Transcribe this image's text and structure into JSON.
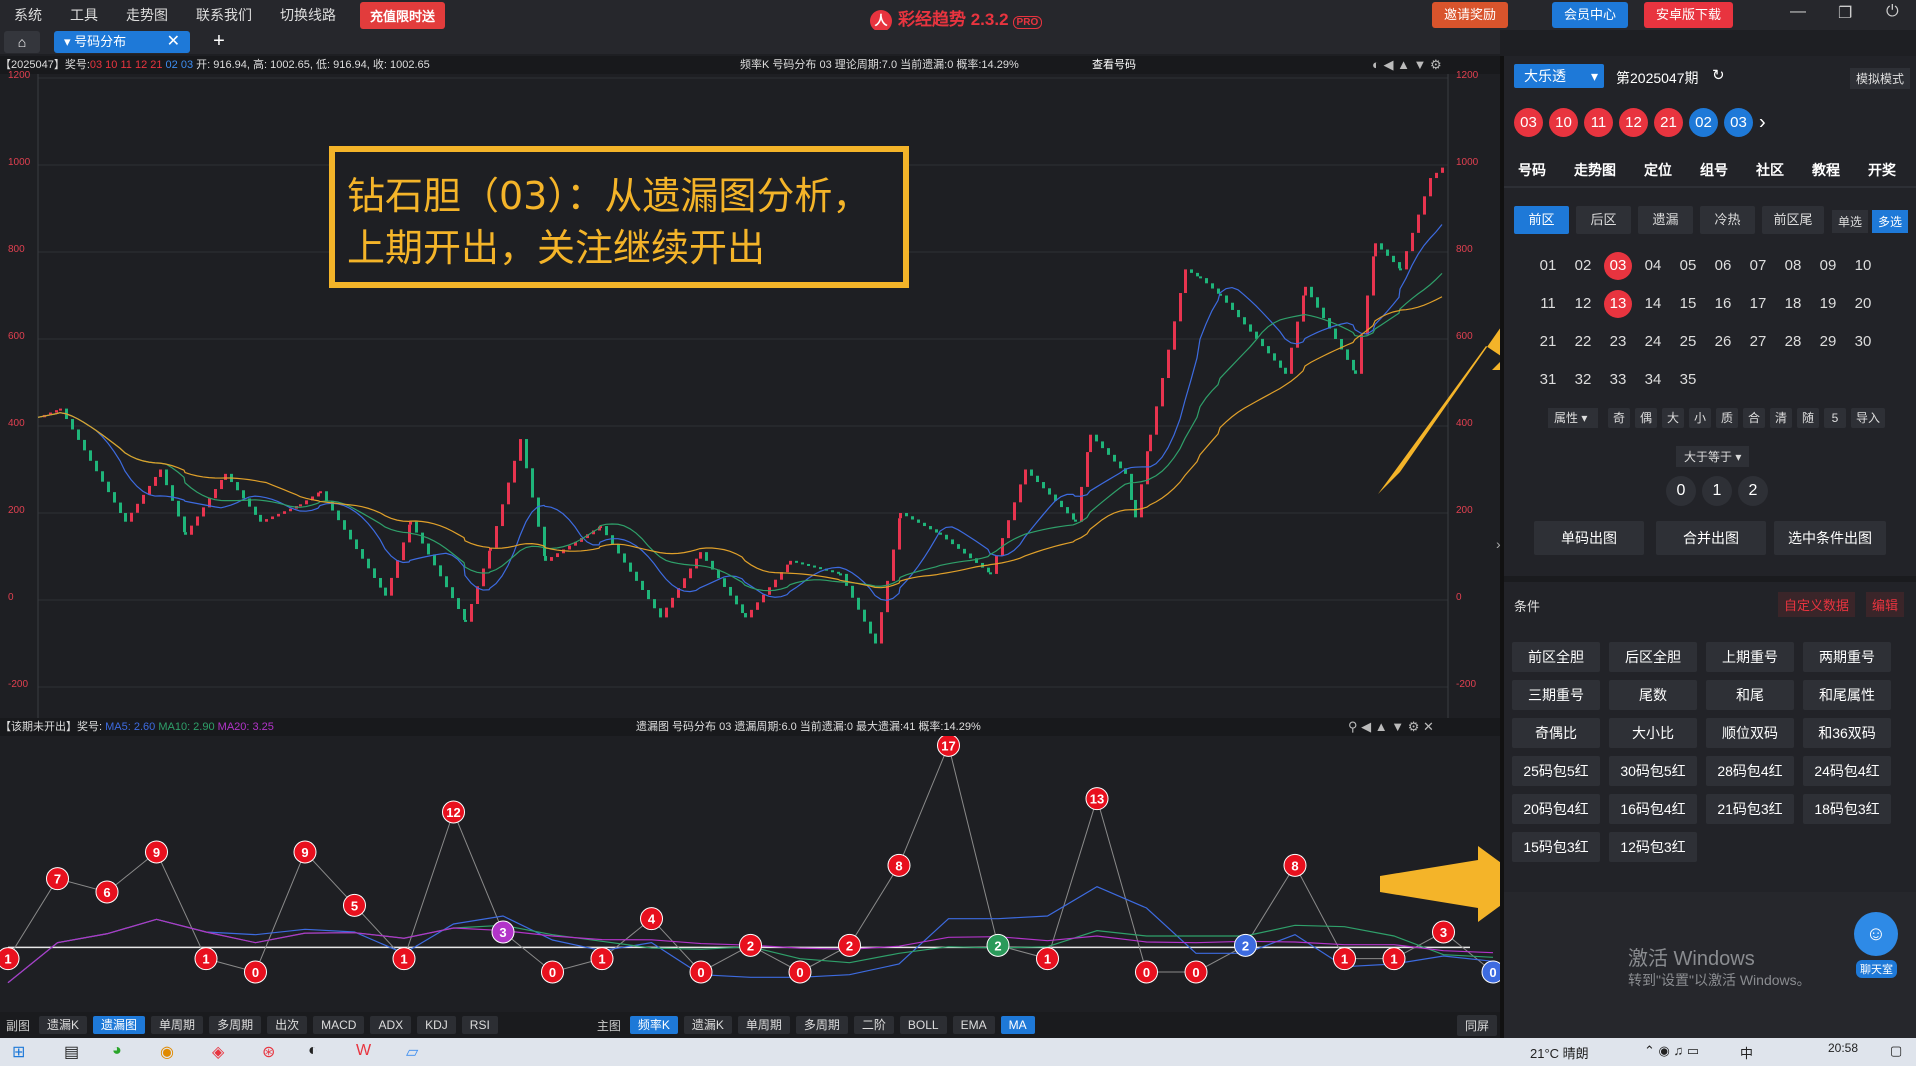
{
  "menu": [
    "系统",
    "工具",
    "走势图",
    "联系我们",
    "切换线路"
  ],
  "promo_label": "充值限时送",
  "app_title": "彩经趋势 2.3.2",
  "app_badge": "PRO",
  "top_buttons": {
    "invite": "邀请奖励",
    "member": "会员中心",
    "android": "安卓版下载"
  },
  "tab_label": "号码分布",
  "upper": {
    "header_left": "【2025047】奖号:",
    "header_nums": "03 10 11 12 21",
    "header_nums_blue": "02 03",
    "header_ohlc": "开: 916.94, 高: 1002.65, 低: 916.94, 收: 1002.65",
    "header_mid": "频率K   号码分布   03      理论周期:7.0   当前遗漏:0   概率:14.29%",
    "header_link": "查看号码",
    "axis_labels": [
      "1200",
      "1000",
      "800",
      "600",
      "400",
      "200",
      "0",
      "-200"
    ]
  },
  "overlay": {
    "line1": "钻石胆（03）：从遗漏图分析，",
    "line2": "上期开出，关注继续开出"
  },
  "lower": {
    "header_left": "【该期未开出】奖号:",
    "header_ma5": "MA5: 2.60",
    "header_ma10": "MA10: 2.90",
    "header_ma20": "MA20: 3.25",
    "header_mid": "遗漏图   号码分布   03      遗漏周期:6.0   当前遗漏:0   最大遗漏:41   概率:14.29%"
  },
  "bottom_left_label": "副图",
  "bottom_left": [
    "遗漏K",
    "遗漏图",
    "单周期",
    "多周期",
    "出次",
    "MACD",
    "ADX",
    "KDJ",
    "RSI"
  ],
  "bottom_left_active": 1,
  "bottom_right_label": "主图",
  "bottom_right": [
    "频率K",
    "遗漏K",
    "单周期",
    "多周期",
    "二阶",
    "BOLL",
    "EMA",
    "MA"
  ],
  "bottom_right_active": [
    0,
    7
  ],
  "same_screen": "同屏",
  "side": {
    "lottery": "大乐透",
    "period": "第2025047期",
    "mode": "模拟模式",
    "red_balls": [
      "03",
      "10",
      "11",
      "12",
      "21"
    ],
    "blue_balls": [
      "02",
      "03"
    ],
    "nav": [
      "号码",
      "走势图",
      "定位",
      "组号",
      "社区",
      "教程",
      "开奖"
    ],
    "subtabs": [
      "前区",
      "后区",
      "遗漏",
      "冷热",
      "前区尾"
    ],
    "single": "单选",
    "multi": "多选",
    "numbers": [
      "01",
      "02",
      "03",
      "04",
      "05",
      "06",
      "07",
      "08",
      "09",
      "10",
      "11",
      "12",
      "13",
      "14",
      "15",
      "16",
      "17",
      "18",
      "19",
      "20",
      "21",
      "22",
      "23",
      "24",
      "25",
      "26",
      "27",
      "28",
      "29",
      "30",
      "31",
      "32",
      "33",
      "34",
      "35"
    ],
    "selected": [
      "03",
      "13"
    ],
    "attr_label": "属性",
    "attrs": [
      "奇",
      "偶",
      "大",
      "小",
      "质",
      "合",
      "清",
      "随",
      "5",
      "导入"
    ],
    "ge_label": "大于等于",
    "counts": [
      "0",
      "1",
      "2"
    ],
    "actions": [
      "单码出图",
      "合并出图",
      "选中条件出图"
    ],
    "cond_label": "条件",
    "custom_data": "自定义数据",
    "edit": "编辑",
    "conditions": [
      "前区全胆",
      "后区全胆",
      "上期重号",
      "两期重号",
      "三期重号",
      "尾数",
      "和尾",
      "和尾属性",
      "奇偶比",
      "大小比",
      "顺位双码",
      "和36双码",
      "25码包5红",
      "30码包5红",
      "28码包4红",
      "24码包4红",
      "20码包4红",
      "16码包4红",
      "21码包3红",
      "18码包3红",
      "15码包3红",
      "12码包3红"
    ],
    "activate_title": "激活 Windows",
    "activate_sub": "转到\"设置\"以激活 Windows。",
    "chat": "聊天室"
  },
  "taskbar": {
    "weather": "21°C 晴朗",
    "time": "20:58",
    "ime": "中"
  },
  "chart_data": {
    "type": "line",
    "title": "",
    "ylim_upper": [
      -200,
      1200
    ],
    "ylim_lower": [
      0,
      18
    ],
    "lower_values": [
      1,
      7,
      6,
      9,
      1,
      0,
      9,
      5,
      1,
      12,
      3,
      0,
      1,
      4,
      0,
      2,
      0,
      2,
      8,
      17,
      2,
      1,
      13,
      0,
      0,
      2,
      8,
      1,
      1,
      3,
      0
    ],
    "lower_colors": [
      "r",
      "r",
      "r",
      "r",
      "r",
      "r",
      "r",
      "r",
      "r",
      "r",
      "p",
      "r",
      "r",
      "r",
      "r",
      "r",
      "r",
      "r",
      "r",
      "r",
      "g",
      "r",
      "r",
      "r",
      "r",
      "b",
      "r",
      "r",
      "r",
      "r",
      "b"
    ]
  }
}
